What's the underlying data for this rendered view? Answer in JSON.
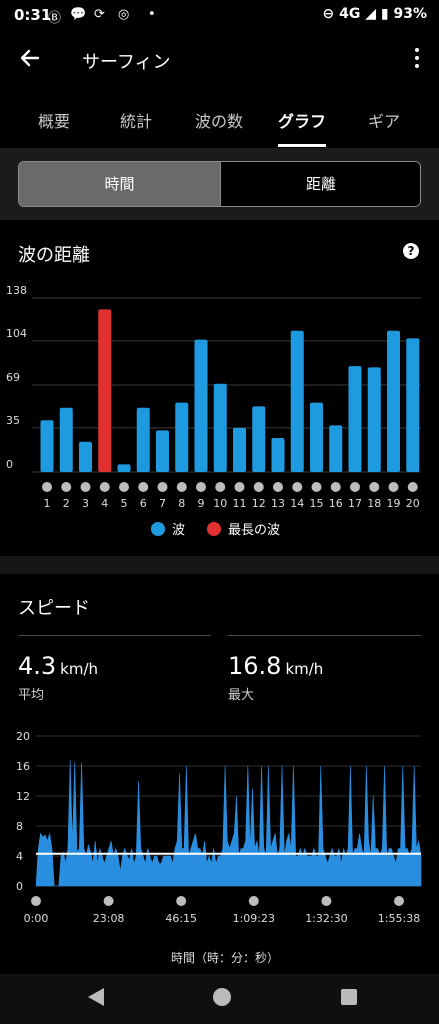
{
  "status": {
    "time": "0:31",
    "network": "4G",
    "battery": "93%"
  },
  "appbar": {
    "title": "サーフィン"
  },
  "tabs": [
    "概要",
    "統計",
    "波の数",
    "グラフ",
    "ギア"
  ],
  "toggle": {
    "left": "時間",
    "right": "距離"
  },
  "wave_distance": {
    "title": "波の距離",
    "help": "?",
    "legend": [
      {
        "label": "波",
        "color": "#1e9be0"
      },
      {
        "label": "最長の波",
        "color": "#e03030"
      }
    ]
  },
  "speed": {
    "title": "スピード",
    "avg_value": "4.3",
    "avg_unit": "km/h",
    "avg_label": "平均",
    "max_value": "16.8",
    "max_unit": "km/h",
    "max_label": "最大",
    "xaxis_label": "時間（時：分：秒）"
  },
  "chart_data": [
    {
      "type": "bar",
      "title": "波の距離",
      "categories": [
        "1",
        "2",
        "3",
        "4",
        "5",
        "6",
        "7",
        "8",
        "9",
        "10",
        "11",
        "12",
        "13",
        "14",
        "15",
        "16",
        "17",
        "18",
        "19",
        "20"
      ],
      "values": [
        41,
        51,
        24,
        129,
        6,
        51,
        33,
        55,
        105,
        70,
        35,
        52,
        27,
        112,
        55,
        37,
        84,
        83,
        112,
        106
      ],
      "ylim": [
        0,
        138
      ],
      "yticks": [
        "0",
        "35",
        "69",
        "104",
        "138"
      ],
      "highlight_index": 3,
      "grid": true,
      "legend_position": "bottom",
      "colors": {
        "normal": "#1e9be0",
        "highlight": "#e03030"
      }
    },
    {
      "type": "area",
      "title": "スピード",
      "xlabel": "時間（時：分：秒）",
      "ylim": [
        0,
        20
      ],
      "yticks": [
        "0",
        "4",
        "8",
        "12",
        "16",
        "20"
      ],
      "xticks": [
        "0:00",
        "23:08",
        "46:15",
        "1:09:23",
        "1:32:30",
        "1:55:38"
      ],
      "average_line": 4.3,
      "grid": true,
      "color": "#2a8ee0",
      "series": [
        {
          "values": [
            0,
            5,
            7,
            6.5,
            6.8,
            6,
            7,
            5,
            0,
            0,
            0,
            4,
            4.5,
            3,
            5,
            16.8,
            5.5,
            16.5,
            4.5,
            5,
            16.5,
            5,
            4,
            5.5,
            4.5,
            3,
            6,
            3,
            5,
            4,
            3,
            4,
            5,
            6,
            4,
            5,
            4,
            2,
            4,
            5,
            4,
            3.5,
            5,
            3,
            4,
            14,
            5,
            4,
            3,
            5,
            4,
            3,
            4,
            4,
            3,
            3,
            4,
            4,
            4,
            4,
            3,
            5,
            6,
            15,
            5,
            5,
            16,
            4,
            5,
            6,
            7,
            5,
            5,
            4,
            6,
            3,
            4,
            3,
            5,
            3,
            4,
            4,
            5,
            16,
            6,
            5,
            6,
            7,
            12,
            4,
            5,
            5,
            6,
            16,
            5,
            13,
            5,
            6,
            4,
            16,
            5,
            4,
            16,
            5,
            6,
            7,
            4,
            5,
            16,
            4,
            6,
            7,
            5,
            16,
            4,
            4,
            5,
            4,
            5,
            4,
            4,
            4,
            5,
            4,
            4,
            16,
            5,
            4,
            3,
            4,
            5,
            4,
            4,
            5,
            3,
            5,
            4,
            5,
            16,
            4,
            5,
            5,
            7,
            5,
            4,
            16,
            6,
            4,
            12,
            5,
            5,
            4,
            5,
            16,
            4,
            5,
            5,
            4,
            3,
            5,
            5,
            16,
            5,
            5,
            4,
            5,
            16,
            5,
            6,
            4
          ]
        }
      ]
    }
  ]
}
